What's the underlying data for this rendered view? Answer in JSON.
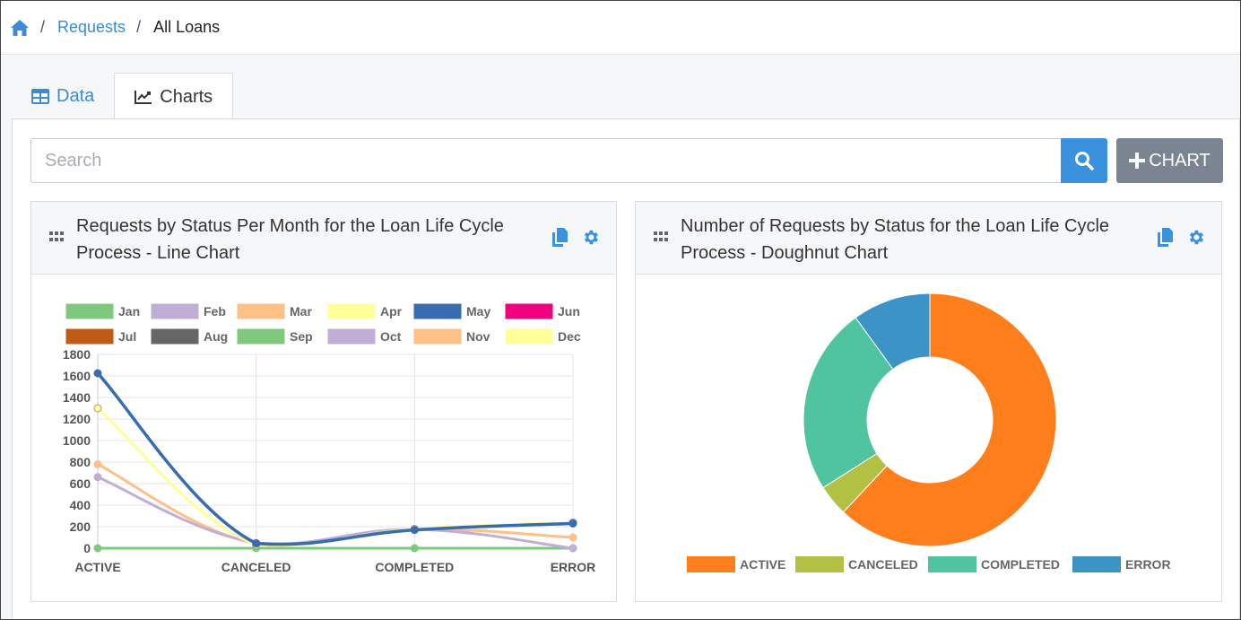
{
  "breadcrumb": {
    "home_icon": "home-icon",
    "link": "Requests",
    "separator": "/",
    "current": "All Loans"
  },
  "tabs": [
    {
      "label": "Data",
      "icon": "table-icon",
      "active": false
    },
    {
      "label": "Charts",
      "icon": "line-chart-icon",
      "active": true
    }
  ],
  "search": {
    "placeholder": "Search",
    "value": "",
    "button_icon": "search-icon"
  },
  "add_chart": {
    "label": "CHART",
    "icon": "plus-icon"
  },
  "colors": {
    "accent": "#3a92df",
    "link": "#3b8bd9",
    "gray_button": "#7b8591"
  },
  "panels": [
    {
      "title": "Requests by Status Per Month for the Loan Life Cycle Process - Line Chart",
      "icons": [
        "grip-icon",
        "copy-icon",
        "gear-icon"
      ]
    },
    {
      "title": "Number of Requests by Status for the Loan Life Cycle Process - Doughnut Chart",
      "icons": [
        "grip-icon",
        "copy-icon",
        "gear-icon"
      ]
    }
  ],
  "chart_data": [
    {
      "type": "line",
      "categories": [
        "ACTIVE",
        "CANCELED",
        "COMPLETED",
        "ERROR"
      ],
      "ylim": [
        0,
        1800
      ],
      "yticks": [
        0,
        200,
        400,
        600,
        800,
        1000,
        1200,
        1400,
        1600,
        1800
      ],
      "grid": true,
      "legend_position": "top",
      "series": [
        {
          "name": "Jan",
          "color": "#7fc97f",
          "values": [
            0,
            0,
            0,
            0
          ]
        },
        {
          "name": "Feb",
          "color": "#c1aed6",
          "values": [
            660,
            50,
            175,
            0
          ]
        },
        {
          "name": "Mar",
          "color": "#fdc086",
          "values": [
            780,
            40,
            175,
            100
          ]
        },
        {
          "name": "Apr",
          "color": "#ffff99",
          "values": [
            1300,
            30,
            180,
            240
          ]
        },
        {
          "name": "May",
          "color": "#386cb0",
          "values": [
            1625,
            45,
            170,
            230
          ]
        },
        {
          "name": "Jun",
          "color": "#f0027f",
          "values": []
        },
        {
          "name": "Jul",
          "color": "#bf5b17",
          "values": []
        },
        {
          "name": "Aug",
          "color": "#666666",
          "values": []
        },
        {
          "name": "Sep",
          "color": "#7fc97f",
          "values": []
        },
        {
          "name": "Oct",
          "color": "#c1aed6",
          "values": []
        },
        {
          "name": "Nov",
          "color": "#fdc086",
          "values": []
        },
        {
          "name": "Dec",
          "color": "#ffff99",
          "values": []
        }
      ]
    },
    {
      "type": "pie",
      "subtype": "doughnut",
      "legend_position": "bottom",
      "categories": [
        "ACTIVE",
        "CANCELED",
        "COMPLETED",
        "ERROR"
      ],
      "values": [
        62,
        4,
        24,
        10
      ],
      "colors": [
        "#fd7e1a",
        "#b2c043",
        "#50c49e",
        "#3c93c5"
      ]
    }
  ]
}
